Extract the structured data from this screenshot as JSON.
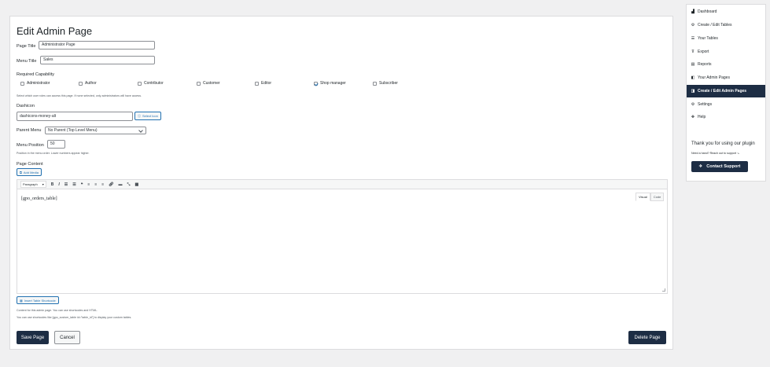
{
  "page": {
    "title": "Edit Admin Page",
    "page_title_label": "Page Title",
    "page_title_value": "Administrator Page",
    "menu_title_label": "Menu Title",
    "menu_title_value": "Sales",
    "required_capability_label": "Required Capability",
    "capabilities": [
      {
        "label": "Administrator",
        "checked": false
      },
      {
        "label": "Author",
        "checked": false
      },
      {
        "label": "Contributor",
        "checked": false
      },
      {
        "label": "Customer",
        "checked": false
      },
      {
        "label": "Editor",
        "checked": false
      },
      {
        "label": "Shop manager",
        "checked": true
      },
      {
        "label": "Subscriber",
        "checked": false
      }
    ],
    "capability_desc": "Select which user roles can access this page. If none selected, only administrators will have access.",
    "dashicon_label": "Dashicon",
    "dashicon_value": "dashicons-money-alt",
    "select_icon_label": "Select Icon",
    "parent_menu_label": "Parent Menu",
    "parent_menu_value": "No Parent (Top Level Menu)",
    "menu_position_label": "Menu Position",
    "menu_position_value": "50",
    "menu_position_desc": "Position in the menu order. Lower numbers appear higher.",
    "page_content_label": "Page Content",
    "add_media_label": "Add Media",
    "editor": {
      "format": "Paragraph",
      "tab_visual": "Visual",
      "tab_code": "Code",
      "content": "[gpo_orders_table]"
    },
    "insert_shortcode_label": "Insert Table Shortcode",
    "content_desc_1": "Content for this admin page. You can use shortcodes and HTML.",
    "content_desc_2": "You can use shortcodes like [gpo_custom_table id=\"table_id\"] to display your custom tables.",
    "save_label": "Save Page",
    "cancel_label": "Cancel",
    "delete_label": "Delete Page"
  },
  "sidebar": {
    "items": [
      {
        "label": "Dashboard",
        "icon": "chart-bar-icon",
        "glyph": "▟",
        "active": false
      },
      {
        "label": "Create / Edit Tables",
        "icon": "gear-icon",
        "glyph": "⚙",
        "active": false
      },
      {
        "label": "Your Tables",
        "icon": "table-icon",
        "glyph": "☰",
        "active": false
      },
      {
        "label": "Export",
        "icon": "filter-icon",
        "glyph": "⊽",
        "active": false
      },
      {
        "label": "Reports",
        "icon": "document-icon",
        "glyph": "▤",
        "active": false
      },
      {
        "label": "Your Admin Pages",
        "icon": "pages-icon",
        "glyph": "◧",
        "active": false
      },
      {
        "label": "Create / Edit Admin Pages",
        "icon": "edit-page-icon",
        "glyph": "◨",
        "active": true
      },
      {
        "label": "Settings",
        "icon": "gear-icon",
        "glyph": "⚙",
        "active": false
      },
      {
        "label": "Help",
        "icon": "help-icon",
        "glyph": "✥",
        "active": false
      }
    ],
    "thanks": "Thank you for using our plugin",
    "reach": "Need a hand? Reach out to support ↘",
    "support_label": "Contact Support"
  },
  "colors": {
    "accent": "#1d2d44",
    "link": "#2271b1",
    "background": "#f0f0f1"
  }
}
